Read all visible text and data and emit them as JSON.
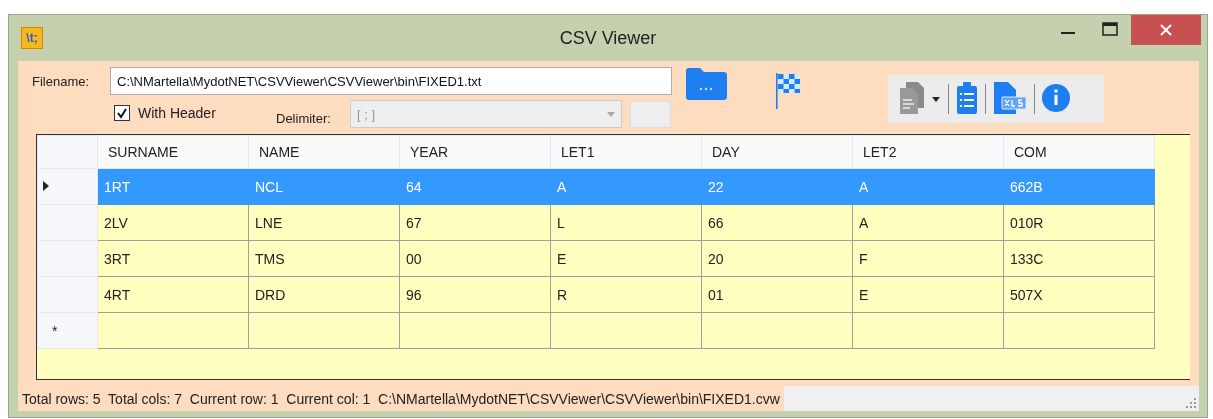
{
  "window": {
    "title": "CSV Viewer",
    "app_icon": "\\t;"
  },
  "filename": {
    "label": "Filename:",
    "value": "C:\\NMartella\\MydotNET\\CSVViewer\\CSVViewer\\bin\\FIXED1.txt"
  },
  "with_header": {
    "label": "With Header",
    "checked": true
  },
  "delimiter": {
    "label": "Delimiter:",
    "value": "[ ; ]",
    "disabled": true
  },
  "table": {
    "columns": [
      "SURNAME",
      "NAME",
      "YEAR",
      "LET1",
      "DAY",
      "LET2",
      "COM"
    ],
    "rows": [
      {
        "selected": true,
        "current": true,
        "cells": [
          "1RT",
          "NCL",
          "64",
          "A",
          "22",
          "A",
          "662B"
        ]
      },
      {
        "selected": false,
        "current": false,
        "cells": [
          "2LV",
          "LNE",
          "67",
          "L",
          "66",
          "A",
          "010R"
        ]
      },
      {
        "selected": false,
        "current": false,
        "cells": [
          "3RT",
          "TMS",
          "00",
          "E",
          "20",
          "F",
          "133C"
        ]
      },
      {
        "selected": false,
        "current": false,
        "cells": [
          "4RT",
          "DRD",
          "96",
          "R",
          "01",
          "E",
          "507X"
        ]
      },
      {
        "selected": false,
        "current": false,
        "marker": "*",
        "cells": [
          "",
          "",
          "",
          "",
          "",
          "",
          ""
        ]
      }
    ]
  },
  "status_bar": {
    "text": "Total rows: 5  Total cols: 7  Current row: 1  Current col: 1  C:\\NMartella\\MydotNET\\CSVViewer\\CSVViewer\\bin\\FIXED1.cvw"
  }
}
